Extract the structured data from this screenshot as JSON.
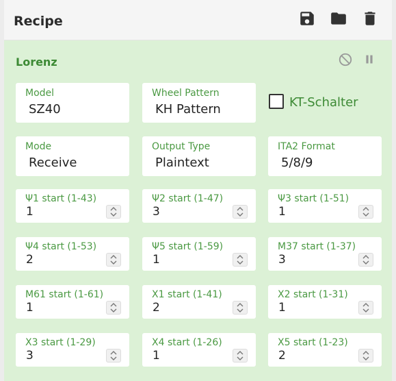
{
  "header": {
    "title": "Recipe"
  },
  "operation": {
    "title": "Lorenz",
    "model": {
      "label": "Model",
      "value": "SZ40"
    },
    "wheel_pattern": {
      "label": "Wheel Pattern",
      "value": "KH Pattern"
    },
    "kt_schalter": {
      "label": "KT-Schalter",
      "checked": false
    },
    "mode": {
      "label": "Mode",
      "value": "Receive"
    },
    "output_type": {
      "label": "Output Type",
      "value": "Plaintext"
    },
    "ita2_format": {
      "label": "ITA2 Format",
      "value": "5/8/9"
    },
    "starts": [
      {
        "label": "Ψ1 start (1-43)",
        "value": "1"
      },
      {
        "label": "Ψ2 start (1-47)",
        "value": "3"
      },
      {
        "label": "Ψ3 start (1-51)",
        "value": "1"
      },
      {
        "label": "Ψ4 start (1-53)",
        "value": "2"
      },
      {
        "label": "Ψ5 start (1-59)",
        "value": "1"
      },
      {
        "label": "M37 start (1-37)",
        "value": "3"
      },
      {
        "label": "M61 start (1-61)",
        "value": "1"
      },
      {
        "label": "X1 start (1-41)",
        "value": "2"
      },
      {
        "label": "X2 start (1-31)",
        "value": "1"
      },
      {
        "label": "X3 start (1-29)",
        "value": "3"
      },
      {
        "label": "X4 start (1-26)",
        "value": "1"
      },
      {
        "label": "X5 start (1-23)",
        "value": "2"
      }
    ]
  },
  "icons": {
    "save": "save-icon",
    "folder": "folder-icon",
    "delete": "trash-icon",
    "disable": "block-icon",
    "breakpoint": "pause-icon"
  },
  "colors": {
    "accent": "#3d8a35",
    "operation_bg": "#dcf1d6"
  }
}
